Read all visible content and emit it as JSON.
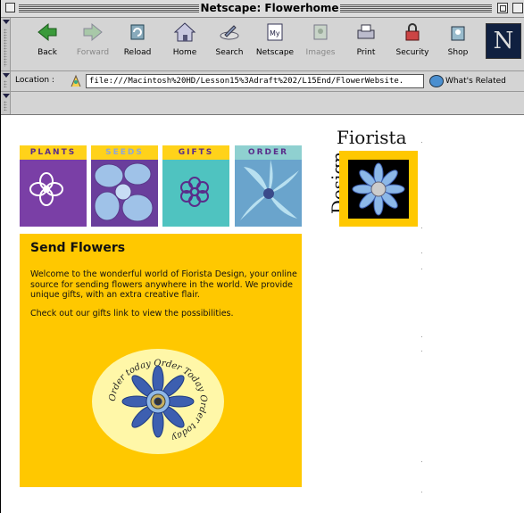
{
  "window": {
    "title": "Netscape: Flowerhome"
  },
  "toolbar": {
    "buttons": [
      {
        "label": "Back",
        "icon": "back-arrow-icon",
        "enabled": true
      },
      {
        "label": "Forward",
        "icon": "forward-arrow-icon",
        "enabled": false
      },
      {
        "label": "Reload",
        "icon": "reload-icon",
        "enabled": true
      },
      {
        "label": "Home",
        "icon": "home-icon",
        "enabled": true
      },
      {
        "label": "Search",
        "icon": "search-icon",
        "enabled": true
      },
      {
        "label": "Netscape",
        "icon": "my-netscape-icon",
        "enabled": true
      },
      {
        "label": "Images",
        "icon": "images-icon",
        "enabled": false
      },
      {
        "label": "Print",
        "icon": "print-icon",
        "enabled": true
      },
      {
        "label": "Security",
        "icon": "security-lock-icon",
        "enabled": true
      },
      {
        "label": "Shop",
        "icon": "shop-icon",
        "enabled": true
      }
    ],
    "brand_letter": "N"
  },
  "location": {
    "label": "Location :",
    "url": "file:///Macintosh%20HD/Lesson15%3Adraft%202/L15End/FlowerWebsite.",
    "whats_related": "What's Related"
  },
  "site": {
    "nav": [
      {
        "label": "PLANTS",
        "color": "#7a3fa6"
      },
      {
        "label": "SEEDS",
        "color": "#8fa6d8"
      },
      {
        "label": "GIFTS",
        "color": "#4fc3c0"
      },
      {
        "label": "ORDER",
        "color": "#7fb8d8"
      }
    ],
    "logo": {
      "line1": "Fiorista",
      "line2": "Design"
    },
    "panel": {
      "heading": "Send Flowers",
      "para1": "Welcome to the wonderful world of Fiorista Design, your online source for sending flowers anywhere in the world. We provide unique gifts, with an extra creative flair.",
      "para2": "Check out our gifts link to view the possibilities.",
      "badge_text": "Order today  Order Today  Order today"
    },
    "colors": {
      "panel_bg": "#ffc800",
      "badge_bg": "#fff7a8",
      "flower_blue": "#3d5fb0"
    }
  }
}
